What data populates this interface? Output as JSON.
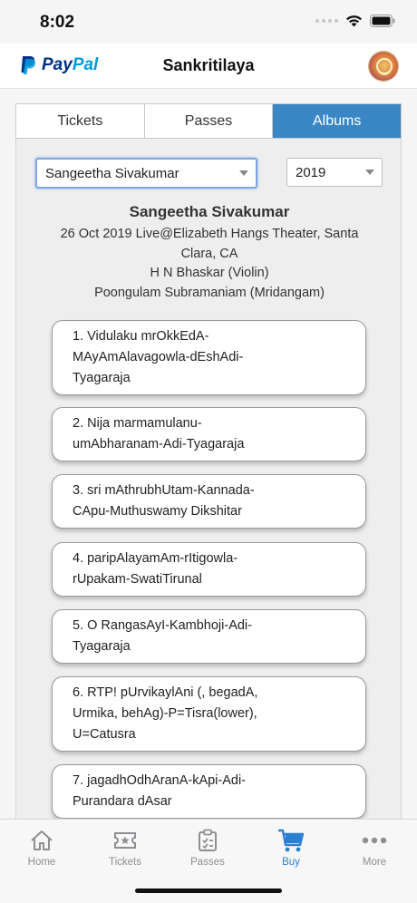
{
  "status_bar": {
    "time": "8:02"
  },
  "header": {
    "brand_pay": "Pay",
    "brand_pal": "Pal",
    "title": "Sankritilaya",
    "avatar_icon": "profile-avatar"
  },
  "tabs": [
    {
      "label": "Tickets",
      "active": false
    },
    {
      "label": "Passes",
      "active": false
    },
    {
      "label": "Albums",
      "active": true
    }
  ],
  "filters": {
    "artist_selected": "Sangeetha Sivakumar",
    "year_selected": "2019"
  },
  "album": {
    "artist": "Sangeetha Sivakumar",
    "lines": [
      "26 Oct 2019 Live@Elizabeth Hangs Theater, Santa",
      "Clara, CA",
      "H N Bhaskar (Violin)",
      "Poongulam Subramaniam (Mridangam)"
    ]
  },
  "tracks": [
    {
      "lines": [
        "1. Vidulaku mrOkkEdA-",
        "MAyAmAlavagowla-dEshAdi-",
        "Tyagaraja"
      ]
    },
    {
      "lines": [
        "2. Nija marmamulanu-",
        "umAbharanam-Adi-Tyagaraja"
      ]
    },
    {
      "lines": [
        "3. sri mAthrubhUtam-Kannada-",
        "CApu-Muthuswamy Dikshitar"
      ]
    },
    {
      "lines": [
        "4. paripAlayamAm-rItigowla-",
        "rUpakam-SwatiTirunal"
      ]
    },
    {
      "lines": [
        "5. O RangasAyI-Kambhoji-Adi-",
        "Tyagaraja"
      ]
    },
    {
      "lines": [
        "6. RTP! pUrvikaylAni (, begadA,",
        "Urmika, behAg)-P=Tisra(lower),",
        "U=Catusra"
      ]
    },
    {
      "lines": [
        "7. jagadhOdhAranA-kApi-Adi-",
        "Purandara dAsar"
      ]
    }
  ],
  "bottom_nav": [
    {
      "label": "Home",
      "icon": "home-icon",
      "active": false
    },
    {
      "label": "Tickets",
      "icon": "ticket-icon",
      "active": false
    },
    {
      "label": "Passes",
      "icon": "clipboard-icon",
      "active": false
    },
    {
      "label": "Buy",
      "icon": "cart-icon",
      "active": true
    },
    {
      "label": "More",
      "icon": "more-icon",
      "active": false
    }
  ],
  "colors": {
    "accent": "#3b87c6",
    "nav_active": "#2b7fd3",
    "nav_inactive": "#8e8e93",
    "paypal_dark": "#003087",
    "paypal_light": "#009cde"
  }
}
